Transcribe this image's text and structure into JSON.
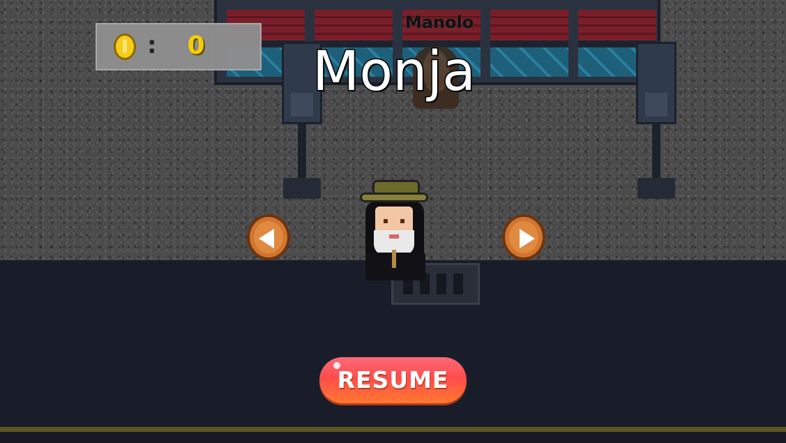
{
  "hud": {
    "coin_icon": "coin-icon",
    "separator": ":",
    "coin_count": "0"
  },
  "npc": {
    "name": "Manolo"
  },
  "character_select": {
    "character_name": "Monja",
    "prev_icon": "arrow-left-icon",
    "next_icon": "arrow-right-icon"
  },
  "menu": {
    "resume_label": "RESUME"
  },
  "colors": {
    "coin": "#ffd11a",
    "arrow_button": "#d2752f",
    "resume_button": "#ff5a4a",
    "road": "#191d2a",
    "road_line": "#5f5624"
  }
}
